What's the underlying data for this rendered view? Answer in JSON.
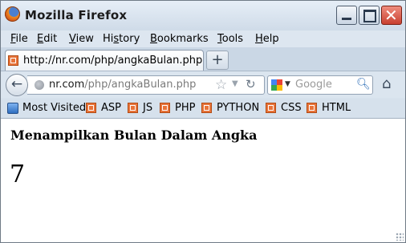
{
  "window": {
    "title": "Mozilla Firefox",
    "controls": {
      "minimize": "minimize",
      "maximize": "maximize",
      "close_glyph": "✕"
    }
  },
  "menu": [
    {
      "label": "File",
      "accel": "F"
    },
    {
      "label": "Edit",
      "accel": "E"
    },
    {
      "label": "View",
      "accel": "V"
    },
    {
      "label": "History",
      "accel": "s"
    },
    {
      "label": "Bookmarks",
      "accel": "B"
    },
    {
      "label": "Tools",
      "accel": "T"
    },
    {
      "label": "Help",
      "accel": "H"
    }
  ],
  "tabs": [
    {
      "title": "http://nr.com/php/angkaBulan.php",
      "active": true
    }
  ],
  "new_tab_label": "+",
  "address": {
    "host": "nr.com",
    "path": "/php/angkaBulan.php"
  },
  "search": {
    "placeholder": "Google"
  },
  "bookmarks": {
    "most_visited": "Most Visited",
    "items": [
      "ASP",
      "JS",
      "PHP",
      "PYTHON",
      "CSS",
      "HTML"
    ]
  },
  "page": {
    "heading": "Menampilkan Bulan Dalam Angka",
    "month_number": "7"
  },
  "colors": {
    "accent_favicon": "#e8743a",
    "close_button": "#c94030",
    "chrome_background": "#d7e2ee"
  },
  "icons": {
    "app": "firefox-logo-icon",
    "back": "back-arrow-icon",
    "site": "globe-icon",
    "bookmark": "star-icon",
    "reload": "reload-icon",
    "search_engine": "google-icon",
    "search": "magnifier-icon",
    "home": "home-icon"
  }
}
